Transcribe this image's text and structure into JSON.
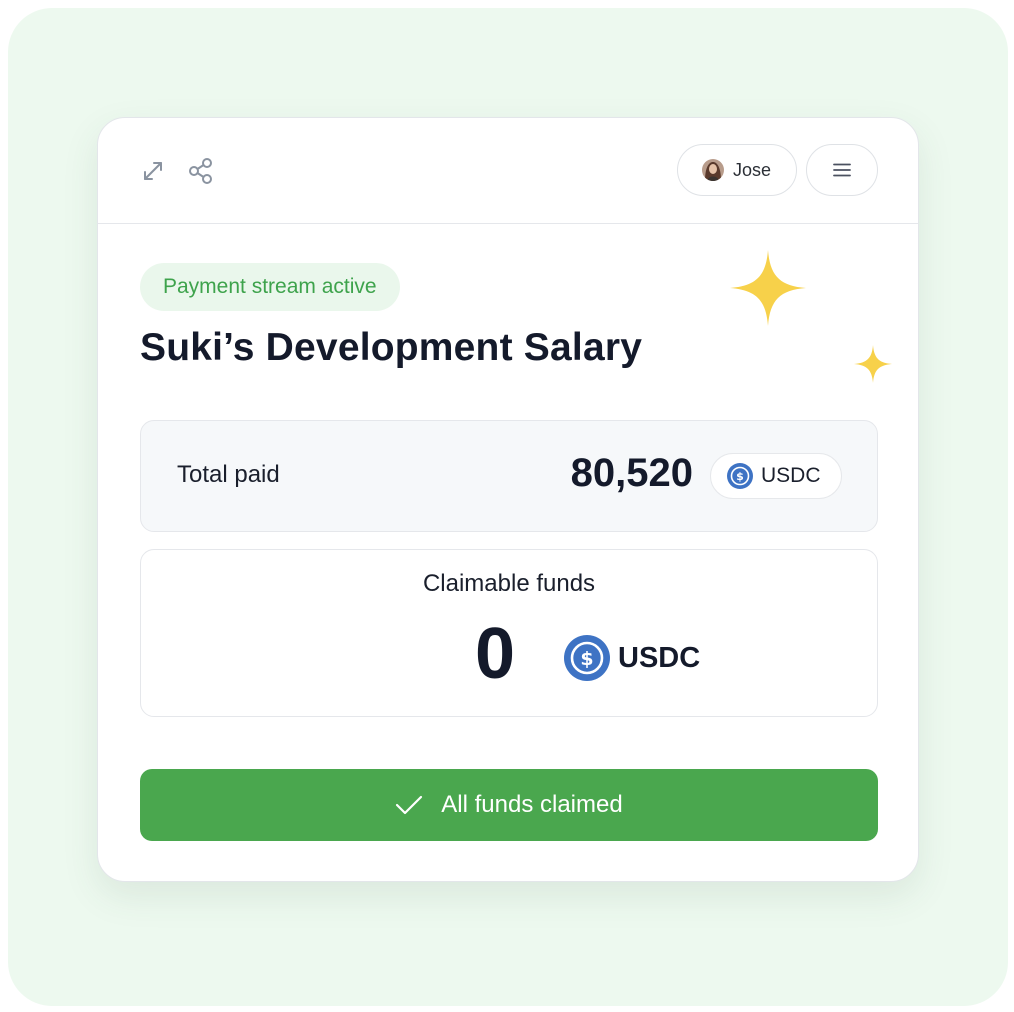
{
  "header": {
    "user_name": "Jose",
    "icons": [
      "expand-icon",
      "share-icon",
      "menu-icon"
    ]
  },
  "stream": {
    "status": "Payment stream active",
    "title": "Suki’s Development Salary"
  },
  "total_paid": {
    "label": "Total paid",
    "value": "80,520",
    "token": "USDC"
  },
  "claimable": {
    "label": "Claimable funds",
    "value": "0",
    "token": "USDC"
  },
  "action": {
    "label": "All funds claimed"
  },
  "colors": {
    "accent_green": "#4aa74e",
    "status_text": "#3ea34c",
    "status_bg": "#eaf7ec",
    "sparkle": "#f7d14a",
    "usdc_blue": "#3e73c4",
    "page_bg": "#edf9ef"
  }
}
